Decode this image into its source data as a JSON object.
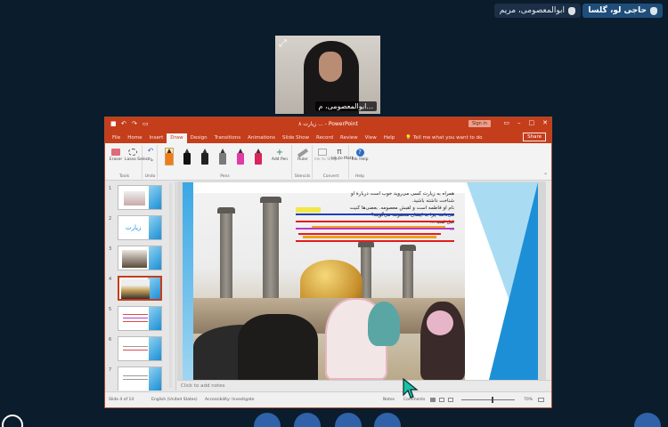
{
  "participants": {
    "primary_label": "حاجی لو، گلسا",
    "secondary_label": "ابوالمعصومی، مریم"
  },
  "webcam": {
    "name_label": "ابوالمعصومی، م..."
  },
  "powerpoint": {
    "document_title": "زیارت ۸ ... - PowerPoint",
    "sign_in": "Sign in",
    "share": "Share",
    "tabs": [
      "File",
      "Home",
      "Insert",
      "Draw",
      "Design",
      "Transitions",
      "Animations",
      "Slide Show",
      "Record",
      "Review",
      "View",
      "Help"
    ],
    "active_tab": "Draw",
    "tell_me": "Tell me what you want to do",
    "ribbon": {
      "tools_eraser": "Eraser",
      "tools_lasso": "Lasso Select",
      "tools_group": "Tools",
      "undo_group": "Undo",
      "pens_group": "Pens",
      "add_pen": "Add Pen",
      "ruler": "Ruler",
      "stencils_group": "Stencils",
      "ink_to_shape": "Ink to Shape",
      "ink_to_math": "Ink to Math",
      "convert_group": "Convert",
      "ink_help": "Ink Help",
      "help_group": "Help"
    },
    "pen_colors": [
      "#f07b1c",
      "#111111",
      "#111111",
      "#7a7a7a",
      "#e23aa8",
      "#d9245c"
    ],
    "thumbnails": [
      {
        "num": "1",
        "label": ""
      },
      {
        "num": "2",
        "label": "زیارت"
      },
      {
        "num": "3",
        "label": ""
      },
      {
        "num": "4",
        "label": ""
      },
      {
        "num": "5",
        "label": ""
      },
      {
        "num": "6",
        "label": ""
      },
      {
        "num": "7",
        "label": ""
      }
    ],
    "slide_text_lines": [
      "همراه به زیارت کسی می‌روید خوب است دربارهٔ او",
      "شناخت داشته باشید.",
      "نام او فاطمه است و لقبش معصومه. بعضی‌ها کنیت",
      "می‌دانند چرا به ایشان معصومه می‌گویند؟",
      "قبل لقب ...",
      "..."
    ],
    "notes_placeholder": "Click to add notes",
    "status": {
      "slide_info": "Slide 4 of 14",
      "language": "English (United States)",
      "accessibility": "Accessibility: Investigate",
      "notes": "Notes",
      "comments": "Comments",
      "zoom": "70%"
    }
  },
  "accent_colors": {
    "ppt_red": "#c43e1c",
    "background": "#0b1c2c",
    "control_blue": "#2f62a8"
  }
}
